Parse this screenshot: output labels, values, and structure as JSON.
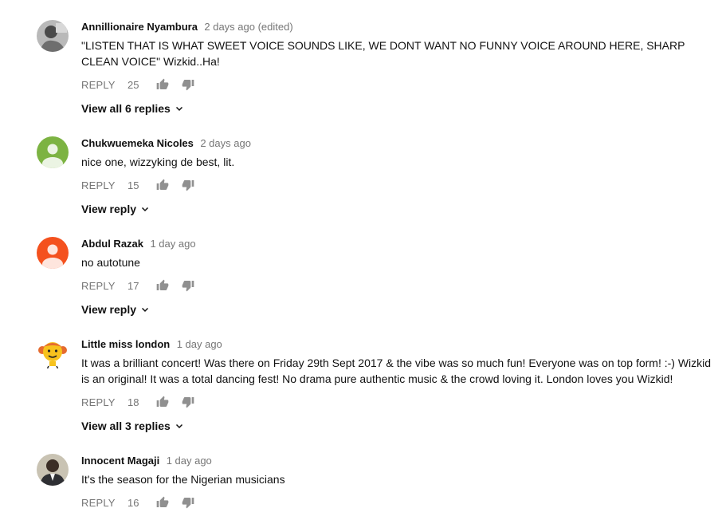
{
  "colors": {
    "text_primary": "#111111",
    "text_secondary": "#767676",
    "icon": "#909090"
  },
  "comments": [
    {
      "author": "Annillionaire Nyambura",
      "timestamp": "2 days ago (edited)",
      "text": "\"LISTEN THAT IS WHAT SWEET VOICE SOUNDS LIKE, WE DONT WANT NO FUNNY VOICE AROUND HERE, SHARP CLEAN VOICE\" Wizkid..Ha!",
      "reply_label": "REPLY",
      "likes": "25",
      "view_replies": "View all 6 replies",
      "avatar_icon": "user-photo-icon",
      "avatar_color": "#8a8a8a"
    },
    {
      "author": "Chukwuemeka Nicoles",
      "timestamp": "2 days ago",
      "text": "nice one, wizzyking de best, lit.",
      "reply_label": "REPLY",
      "likes": "15",
      "view_replies": "View reply",
      "avatar_icon": "default-user-icon",
      "avatar_color": "#7cb342"
    },
    {
      "author": "Abdul Razak",
      "timestamp": "1 day ago",
      "text": "no autotune",
      "reply_label": "REPLY",
      "likes": "17",
      "view_replies": "View reply",
      "avatar_icon": "default-user-icon",
      "avatar_color": "#f4511e"
    },
    {
      "author": "Little miss london",
      "timestamp": "1 day ago",
      "text": "It was a brilliant concert! Was there on Friday 29th Sept 2017 & the vibe was so much fun! Everyone was on top form! :-) Wizkid is an original! It was a total dancing fest! No drama pure authentic music & the crowd loving it. London loves you Wizkid!",
      "reply_label": "REPLY",
      "likes": "18",
      "view_replies": "View all 3 replies",
      "avatar_icon": "cartoon-character-icon",
      "avatar_color": "#f7c21d"
    },
    {
      "author": "Innocent Magaji",
      "timestamp": "1 day ago",
      "text": "It's the season for the Nigerian musicians",
      "reply_label": "REPLY",
      "likes": "16",
      "view_replies": "",
      "avatar_icon": "user-photo-icon",
      "avatar_color": "#5d5a52"
    }
  ]
}
